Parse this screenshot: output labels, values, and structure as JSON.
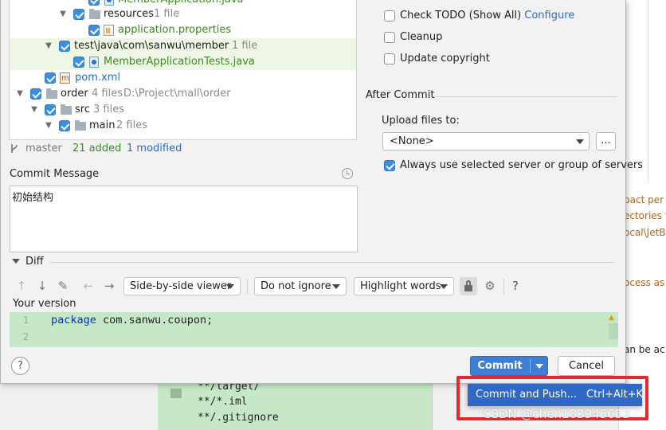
{
  "tree": {
    "rows": [
      {
        "name": "MemberApplication.java",
        "count": ""
      },
      {
        "name": "resources",
        "count": "1 file"
      },
      {
        "name": "application.properties",
        "count": ""
      },
      {
        "name": "test\\java\\com\\sanwu\\member",
        "count": "1 file"
      },
      {
        "name": "MemberApplicationTests.java",
        "count": ""
      },
      {
        "name": "pom.xml",
        "count": ""
      },
      {
        "name": "order",
        "count": "4 files",
        "path": "D:\\Project\\mall\\order"
      },
      {
        "name": "src",
        "count": "3 files"
      },
      {
        "name": "main",
        "count": "2 files"
      }
    ]
  },
  "status": {
    "branch": "master",
    "added": "21 added",
    "modified": "1 modified"
  },
  "commit_message": {
    "label": "Commit Message",
    "value": "初始结构"
  },
  "diff": {
    "label": "Diff",
    "viewer": "Side-by-side viewer",
    "ignore": "Do not ignore",
    "highlight": "Highlight words",
    "help": "?",
    "your_version": "Your version",
    "lines": [
      {
        "num": "1",
        "keyword": "package",
        "text": " com.sanwu.coupon;"
      },
      {
        "num": "2",
        "keyword": "",
        "text": ""
      }
    ]
  },
  "options": {
    "check_todo": "Check TODO (Show All)",
    "configure": "Configure",
    "cleanup": "Cleanup",
    "update_copyright": "Update copyright",
    "after_commit": "After Commit",
    "upload_label": "Upload files to:",
    "upload_value": "<None>",
    "upload_more": "...",
    "always_use": "Always use selected server or group of servers"
  },
  "buttons": {
    "help": "?",
    "commit": "Commit",
    "cancel": "Cancel"
  },
  "popup": {
    "item": "Commit and Push...",
    "shortcut": "Ctrl+Alt+K"
  },
  "background": {
    "right_lines": [
      "pact per",
      "ectories f",
      "ocal\\JetB",
      "ocess as",
      "an be ac"
    ],
    "editor_lines": [
      "**/target/",
      "**/*.iml",
      "**/.gitignore"
    ]
  },
  "watermark": "CSDN @chen183945653",
  "colors": {
    "accent": "#3d7fd6",
    "added": "#3a8a1f",
    "modified": "#2d6bd0",
    "diff_bg": "#c7e8c7",
    "highlight_frame": "#e8282c"
  }
}
